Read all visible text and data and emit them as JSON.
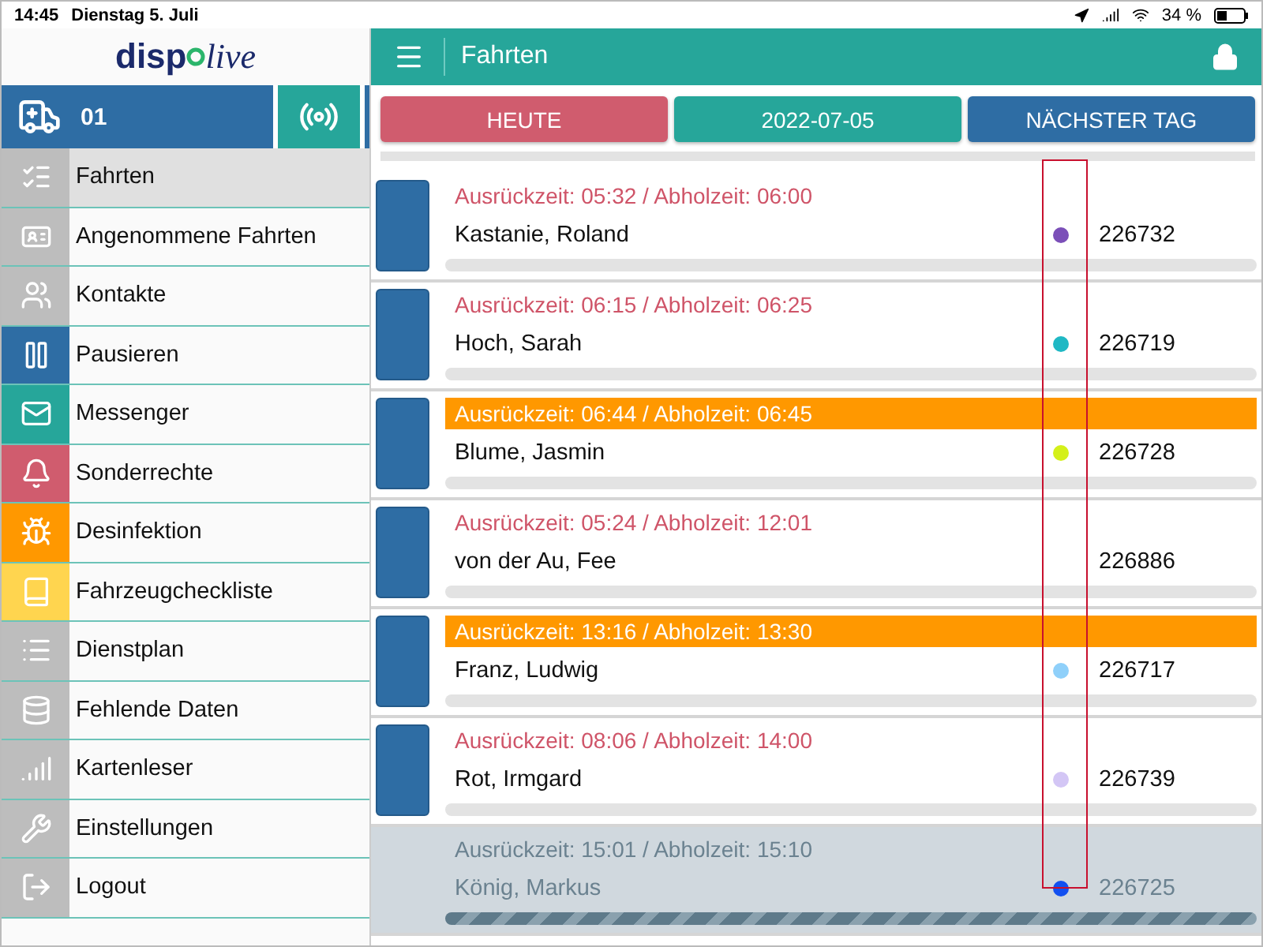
{
  "status_bar": {
    "time": "14:45",
    "date": "Dienstag 5. Juli",
    "battery": "34 %"
  },
  "sidebar": {
    "logo": {
      "left": "disp",
      "right": "live"
    },
    "vehicle": "01",
    "items": [
      {
        "label": "Fahrten",
        "color": "#bdbdbd",
        "selected": true
      },
      {
        "label": "Angenommene Fahrten",
        "color": "#bdbdbd",
        "selected": false
      },
      {
        "label": "Kontakte",
        "color": "#bdbdbd",
        "selected": false
      },
      {
        "label": "Pausieren",
        "color": "#2e6da4",
        "selected": false
      },
      {
        "label": "Messenger",
        "color": "#26a69a",
        "selected": false
      },
      {
        "label": "Sonderrechte",
        "color": "#d05c6e",
        "selected": false
      },
      {
        "label": "Desinfektion",
        "color": "#ff9800",
        "selected": false
      },
      {
        "label": "Fahrzeugcheckliste",
        "color": "#ffd54f",
        "selected": false
      },
      {
        "label": "Dienstplan",
        "color": "#bdbdbd",
        "selected": false
      },
      {
        "label": "Fehlende Daten",
        "color": "#bdbdbd",
        "selected": false
      },
      {
        "label": "Kartenleser",
        "color": "#bdbdbd",
        "selected": false
      },
      {
        "label": "Einstellungen",
        "color": "#bdbdbd",
        "selected": false
      },
      {
        "label": "Logout",
        "color": "#bdbdbd",
        "selected": false
      }
    ],
    "radio_on": true
  },
  "header": {
    "title": "Fahrten"
  },
  "day_buttons": [
    {
      "label": "HEUTE",
      "kind": "today"
    },
    {
      "label": "2022-07-05",
      "kind": "date"
    },
    {
      "label": "NÄCHSTER TAG",
      "kind": "next"
    }
  ],
  "trips": [
    {
      "kind": "normal",
      "times": "Ausrückzeit: 05:32 / Abholzeit: 06:00",
      "name": "Kastanie, Roland",
      "number": "226732",
      "color": "#7b4fb8"
    },
    {
      "kind": "normal",
      "times": "Ausrückzeit: 06:15 / Abholzeit: 06:25",
      "name": "Hoch, Sarah",
      "number": "226719",
      "color": "#1fb8c4"
    },
    {
      "kind": "alert",
      "times": "Ausrückzeit: 06:44 / Abholzeit: 06:45",
      "name": "Blume, Jasmin",
      "number": "226728",
      "color": "#d4f01a"
    },
    {
      "kind": "normal",
      "times": "Ausrückzeit: 05:24 / Abholzeit: 12:01",
      "name": "von der Au, Fee",
      "number": "226886"
    },
    {
      "kind": "alert",
      "times": "Ausrückzeit: 13:16 / Abholzeit: 13:30",
      "name": "Franz, Ludwig",
      "number": "226717",
      "color": "#8fd0fa"
    },
    {
      "kind": "normal",
      "times": "Ausrückzeit: 08:06 / Abholzeit: 14:00",
      "name": "Rot, Irmgard",
      "number": "226739",
      "color": "#d3c6f5"
    },
    {
      "kind": "done",
      "times": "Ausrückzeit: 15:01 / Abholzeit: 15:10",
      "name": "König, Markus",
      "number": "226725",
      "color": "#1250f0"
    }
  ]
}
